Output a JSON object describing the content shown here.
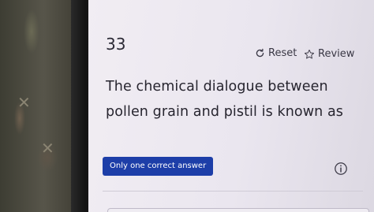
{
  "question": {
    "number": "33",
    "text": "The chemical dialogue between pollen grain and pistil is known as",
    "answer_type_label": "Only one correct answer"
  },
  "actions": {
    "reset_label": "Reset",
    "review_label": "Review",
    "reset_icon": "refresh-icon",
    "review_icon": "star-outline-icon",
    "info_icon": "info-circle-icon"
  },
  "colors": {
    "badge": "#1d3ea8",
    "screen_bg": "#eae6ef",
    "text": "#27252f"
  }
}
